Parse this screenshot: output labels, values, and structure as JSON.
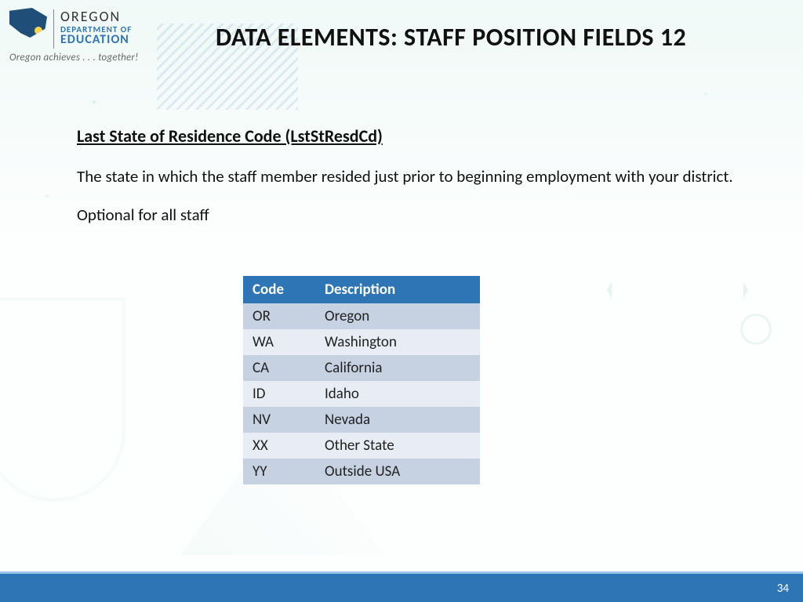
{
  "logo": {
    "line1": "OREGON",
    "line2": "DEPARTMENT OF",
    "line3": "EDUCATION",
    "tagline": "Oregon achieves . . . together!"
  },
  "title": "DATA ELEMENTS: STAFF POSITION FIELDS 12",
  "field": {
    "name": "Last State of Residence Code (LstStResdCd)",
    "description": "The state in which the staff member resided just prior to beginning employment with your district.",
    "optional_note": "Optional for all staff"
  },
  "table": {
    "headers": {
      "code": "Code",
      "description": "Description"
    },
    "rows": [
      {
        "code": "OR",
        "description": "Oregon"
      },
      {
        "code": "WA",
        "description": "Washington"
      },
      {
        "code": "CA",
        "description": "California"
      },
      {
        "code": "ID",
        "description": "Idaho"
      },
      {
        "code": "NV",
        "description": "Nevada"
      },
      {
        "code": "XX",
        "description": "Other State"
      },
      {
        "code": "YY",
        "description": "Outside USA"
      }
    ]
  },
  "page_number": "34"
}
